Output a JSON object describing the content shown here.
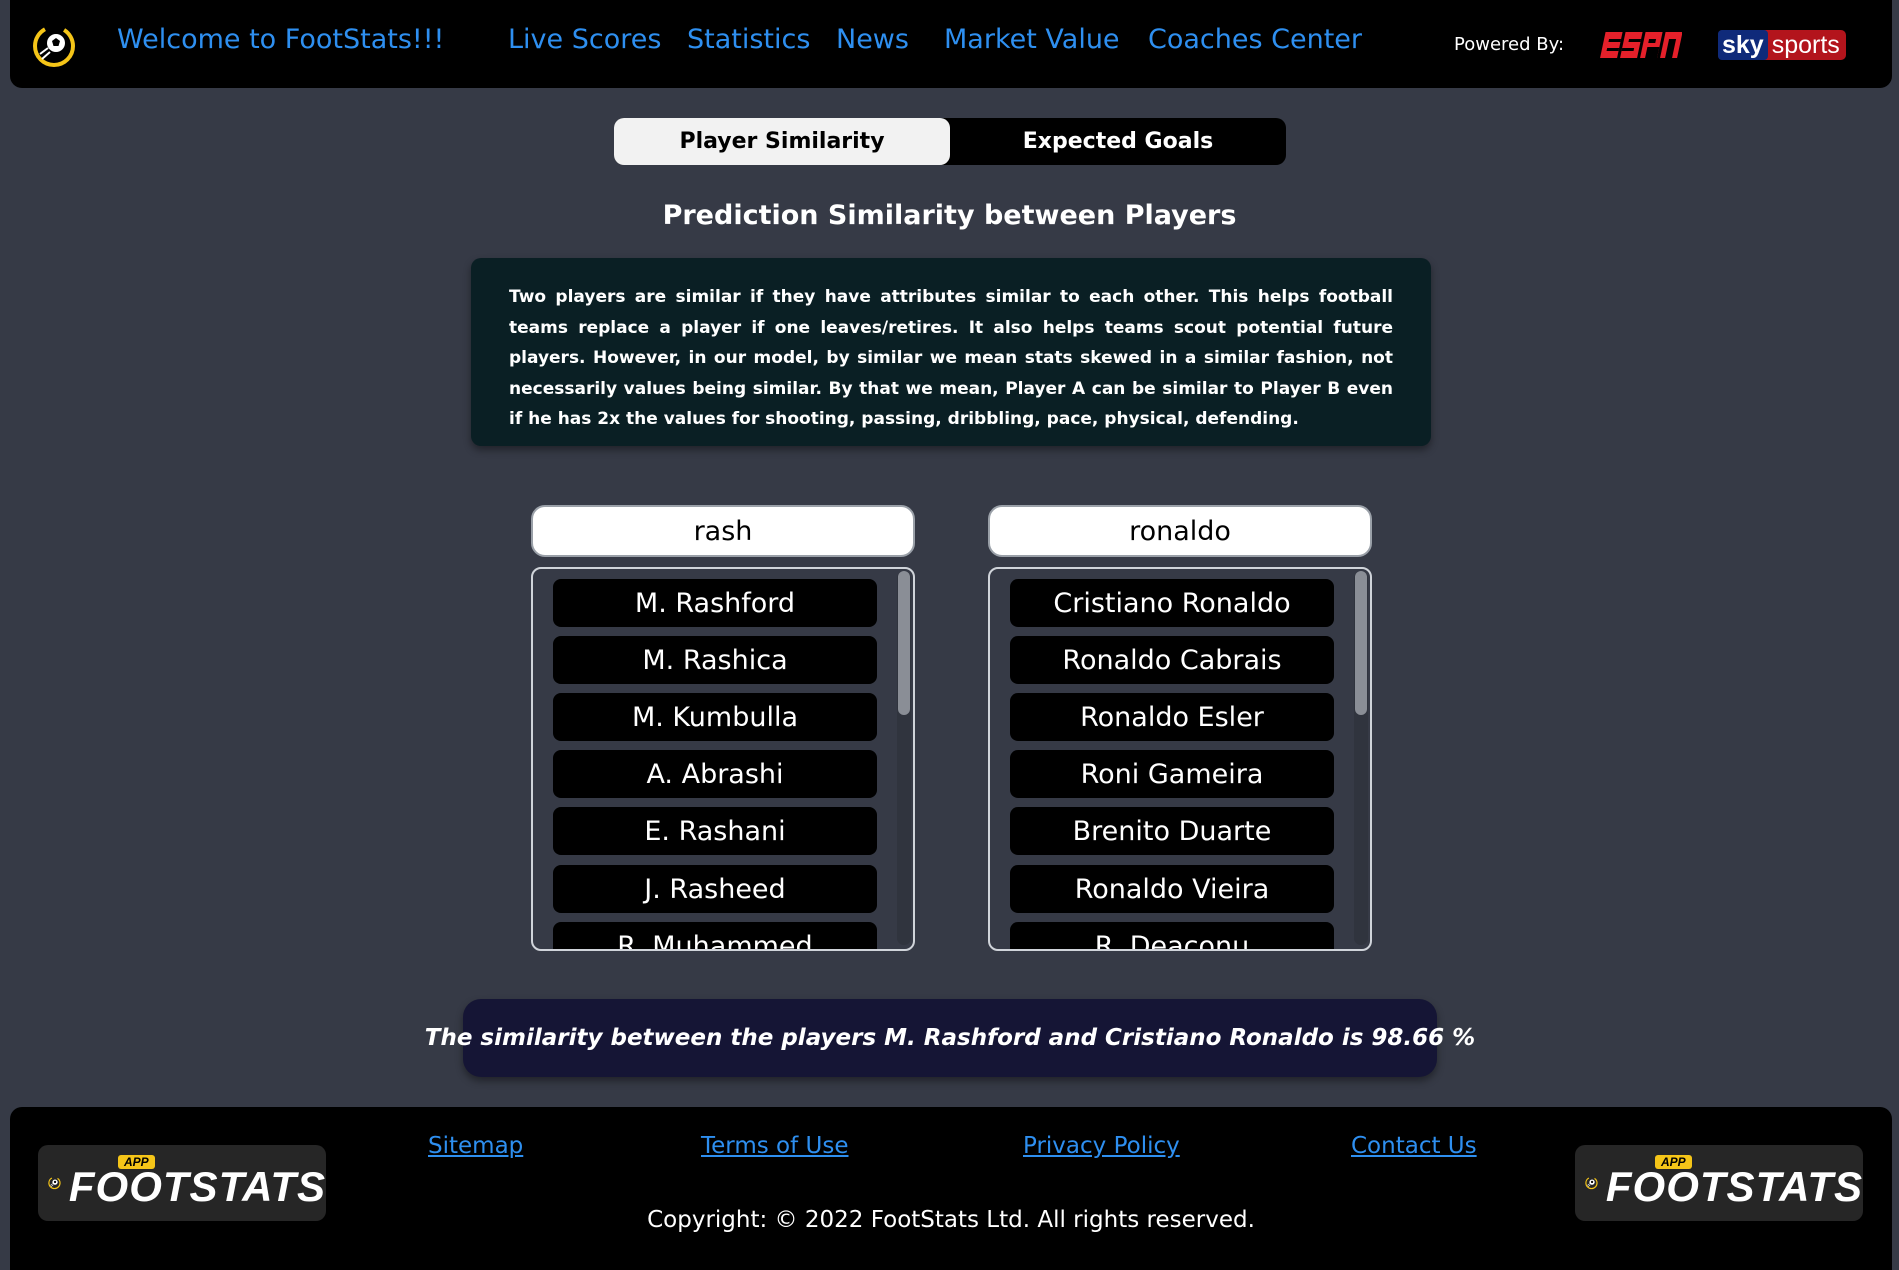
{
  "header": {
    "welcome": "Welcome to FootStats!!!",
    "nav": [
      {
        "label": "Live Scores"
      },
      {
        "label": "Statistics"
      },
      {
        "label": "News"
      },
      {
        "label": "Market Value"
      },
      {
        "label": "Coaches Center"
      }
    ],
    "powered_by": "Powered By:",
    "partners": [
      {
        "name": "ESPN",
        "icon": "espn-logo"
      },
      {
        "name": "sky sports",
        "icon": "sky-sports-logo",
        "parts": [
          "sky",
          "sports"
        ]
      }
    ]
  },
  "tabs": [
    {
      "label": "Player Similarity",
      "active": true
    },
    {
      "label": "Expected Goals",
      "active": false
    }
  ],
  "page_title": "Prediction Similarity between Players",
  "description": "Two players are similar if they have attributes similar to each other. This helps football teams replace a player if one leaves/retires. It also helps teams scout potential future players. However, in our model, by similar we mean stats skewed in a similar fashion, not necessarily values being similar. By that we mean, Player A can be similar to Player B even if he has 2x the values for shooting, passing, dribbling, pace, physical, defending.",
  "player_a": {
    "search_value": "rash",
    "results": [
      "M. Rashford",
      "M. Rashica",
      "M. Kumbulla",
      "A. Abrashi",
      "E. Rashani",
      "J. Rasheed",
      "R. Muhammed"
    ]
  },
  "player_b": {
    "search_value": "ronaldo",
    "results": [
      "Cristiano Ronaldo",
      "Ronaldo Cabrais",
      "Ronaldo Esler",
      "Roni Gameira",
      "Brenito Duarte",
      "Ronaldo Vieira",
      "R. Deaconu"
    ]
  },
  "result": "The similarity between the players M. Rashford and Cristiano Ronaldo is 98.66 %",
  "footer": {
    "logo_text": "FOOTSTATS",
    "logo_badge": "APP",
    "links": [
      {
        "label": "Sitemap"
      },
      {
        "label": "Terms of Use"
      },
      {
        "label": "Privacy Policy"
      },
      {
        "label": "Contact Us"
      }
    ],
    "copyright": "Copyright: © 2022 FootStats Ltd. All rights reserved."
  },
  "colors": {
    "background": "#363a46",
    "bar": "#000000",
    "link": "#2e8ff0",
    "info_box": "#0a1f24",
    "result_box": "#151535",
    "logo_yellow": "#f5c518",
    "espn_red": "#e4202a"
  }
}
